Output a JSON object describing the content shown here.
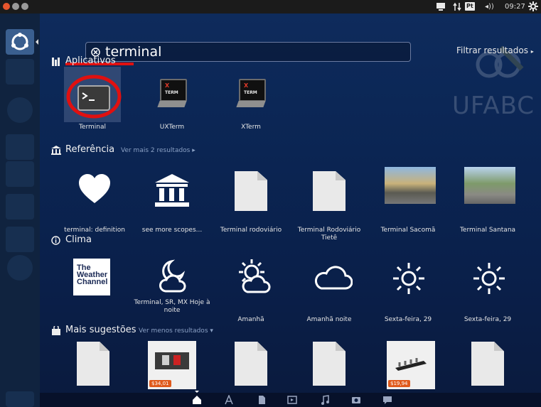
{
  "top_panel": {
    "keyboard_layout": "Pt",
    "volume": "◂))",
    "clock": "09:27"
  },
  "search": {
    "value": "terminal",
    "filter_label": "Filtrar resultados"
  },
  "watermark": "UFABC",
  "sections": {
    "aplicativos": {
      "title": "Aplicativos",
      "items": [
        "Terminal",
        "UXTerm",
        "XTerm"
      ]
    },
    "referencia": {
      "title": "Referência",
      "more": "Ver mais 2 resultados",
      "items": [
        "terminal: definition",
        "see more scopes...",
        "Terminal rodoviário",
        "Terminal Rodoviário Tietê",
        "Terminal Sacomã",
        "Terminal Santana"
      ]
    },
    "clima": {
      "title": "Clima",
      "weather_channel": [
        "The",
        "Weather",
        "Channel"
      ],
      "items": [
        "Terminal, SR, MX Hoje à noite",
        "Amanhã",
        "Amanhã noite",
        "Sexta-feira, 29",
        "Sexta-feira, 29"
      ]
    },
    "sugestoes": {
      "title": "Mais sugestões",
      "more": "Ver menos resultados",
      "prices": [
        "$34,01",
        "$19,94"
      ]
    }
  },
  "xterm_text": {
    "x": "X",
    "term": "TERM"
  }
}
